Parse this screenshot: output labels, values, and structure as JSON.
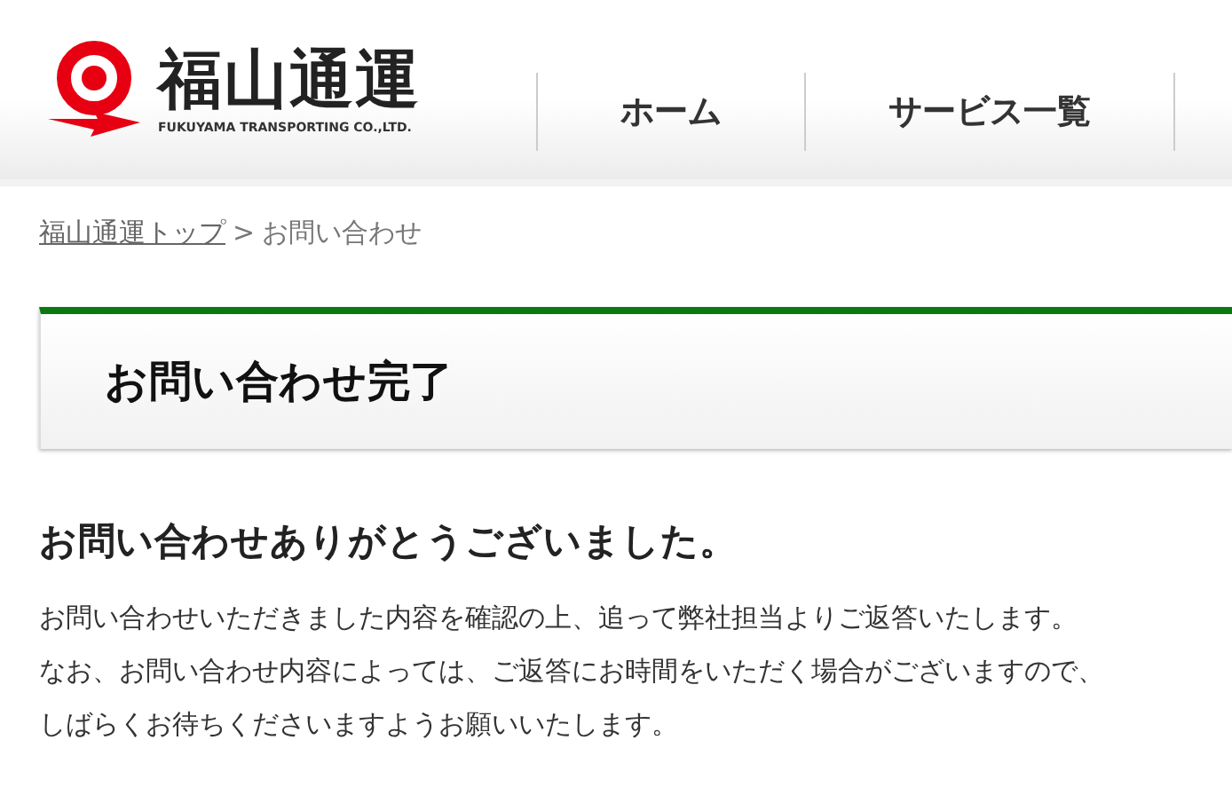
{
  "header": {
    "logo": {
      "name": "福山通運",
      "subtitle": "FUKUYAMA TRANSPORTING CO.,LTD."
    },
    "nav": [
      {
        "label": "ホーム"
      },
      {
        "label": "サービス一覧"
      }
    ]
  },
  "breadcrumb": {
    "link": "福山通運トップ",
    "separator": ">",
    "current": "お問い合わせ"
  },
  "page_title": "お問い合わせ完了",
  "message": {
    "heading": "お問い合わせありがとうございました。",
    "lines": [
      "お問い合わせいただきました内容を確認の上、追って弊社担当よりご返答いたします。",
      "なお、お問い合わせ内容によっては、ご返答にお時間をいただく場合がございますので、",
      "しばらくお待ちくださいますようお願いいたします。"
    ]
  }
}
